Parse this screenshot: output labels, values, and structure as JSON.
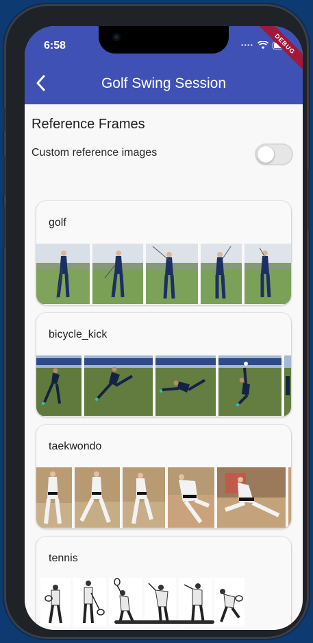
{
  "status_bar": {
    "time": "6:58",
    "debug_banner": "DEBUG"
  },
  "app_bar": {
    "title": "Golf Swing Session",
    "back_icon": "chevron-left-icon"
  },
  "section": {
    "title": "Reference Frames"
  },
  "custom_toggle": {
    "label": "Custom reference images",
    "value": false
  },
  "colors": {
    "app_bar": "#3f51b5",
    "background": "#f8f8f8",
    "debug": "#a0183a"
  },
  "cards": [
    {
      "title": "golf",
      "frames": [
        "golf-swing-frame",
        "golf-swing-frame",
        "golf-swing-frame",
        "golf-swing-frame",
        "golf-swing-frame"
      ]
    },
    {
      "title": "bicycle_kick",
      "frames": [
        "bicycle-kick-frame",
        "bicycle-kick-frame",
        "bicycle-kick-frame",
        "bicycle-kick-frame",
        "bicycle-kick-frame"
      ]
    },
    {
      "title": "taekwondo",
      "frames": [
        "taekwondo-frame",
        "taekwondo-frame",
        "taekwondo-frame",
        "taekwondo-frame",
        "taekwondo-frame",
        "taekwondo-frame"
      ]
    },
    {
      "title": "tennis",
      "frames": [
        "tennis-frame",
        "tennis-frame",
        "tennis-frame",
        "tennis-frame",
        "tennis-frame",
        "tennis-frame"
      ]
    }
  ]
}
